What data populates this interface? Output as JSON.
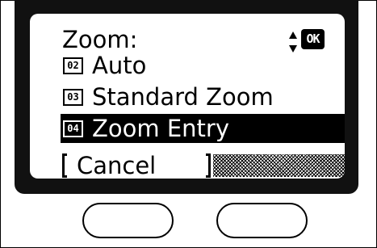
{
  "screen": {
    "title": "Zoom:",
    "ok_icon_text": "OK",
    "options": [
      {
        "number": "02",
        "label": "Auto",
        "selected": false
      },
      {
        "number": "03",
        "label": "Standard Zoom",
        "selected": false
      },
      {
        "number": "04",
        "label": "Zoom Entry",
        "selected": true
      }
    ],
    "cancel_label": "Cancel"
  },
  "icons": {
    "scroll": "up-down-scroll-icon",
    "ok": "ok-icon"
  },
  "colors": {
    "lcd_background": "#ffffff",
    "bezel": "#111111",
    "highlight": "#000000"
  }
}
